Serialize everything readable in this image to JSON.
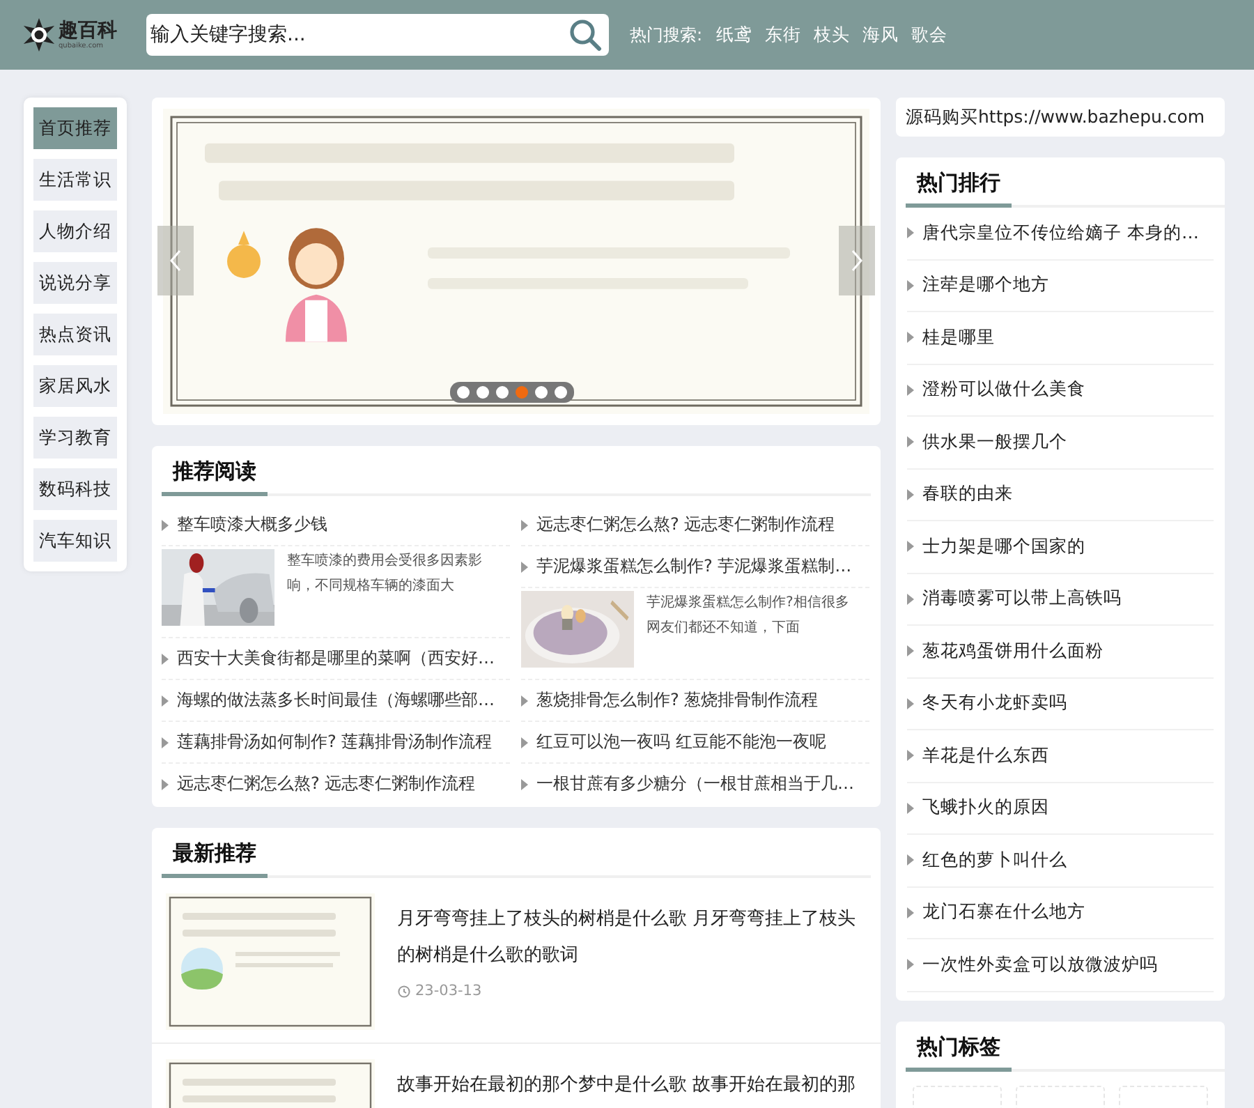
{
  "header": {
    "logo": {
      "name": "趣百科",
      "domain": "qubaike.com"
    },
    "search": {
      "placeholder": "输入关键字搜索..."
    },
    "hot_search": {
      "label": "热门搜索:",
      "terms": [
        "纸鸢",
        "东街",
        "枝头",
        "海风",
        "歌会"
      ]
    }
  },
  "nav": [
    {
      "label": "首页推荐",
      "selected": true
    },
    {
      "label": "生活常识",
      "selected": false
    },
    {
      "label": "人物介绍",
      "selected": false
    },
    {
      "label": "说说分享",
      "selected": false
    },
    {
      "label": "热点资讯",
      "selected": false
    },
    {
      "label": "家居风水",
      "selected": false
    },
    {
      "label": "学习教育",
      "selected": false
    },
    {
      "label": "数码科技",
      "selected": false
    },
    {
      "label": "汽车知识",
      "selected": false
    }
  ],
  "carousel": {
    "dots": [
      {
        "selected": false
      },
      {
        "selected": false
      },
      {
        "selected": false
      },
      {
        "selected": true
      },
      {
        "selected": false
      },
      {
        "selected": false
      }
    ]
  },
  "recommend": {
    "title": "推荐阅读",
    "columns": [
      [
        {
          "kind": "title",
          "text": "整车喷漆大概多少钱"
        },
        {
          "kind": "excerpt",
          "text": "整车喷漆的费用会受很多因素影响，不同规格车辆的漆面大"
        },
        {
          "kind": "title",
          "text": "西安十大美食街都是哪里的菜啊（西安好…"
        },
        {
          "kind": "title",
          "text": "海螺的做法蒸多长时间最佳（海螺哪些部…"
        },
        {
          "kind": "title",
          "text": "莲藕排骨汤如何制作? 莲藕排骨汤制作流程"
        },
        {
          "kind": "title",
          "text": "远志枣仁粥怎么熬? 远志枣仁粥制作流程"
        }
      ],
      [
        {
          "kind": "title",
          "text": "远志枣仁粥怎么熬? 远志枣仁粥制作流程"
        },
        {
          "kind": "title",
          "text": "芋泥爆浆蛋糕怎么制作? 芋泥爆浆蛋糕制…"
        },
        {
          "kind": "excerpt",
          "text": "芋泥爆浆蛋糕怎么制作?相信很多网友们都还不知道，下面"
        },
        {
          "kind": "title",
          "text": "葱烧排骨怎么制作? 葱烧排骨制作流程"
        },
        {
          "kind": "title",
          "text": "红豆可以泡一夜吗 红豆能不能泡一夜呢"
        },
        {
          "kind": "title",
          "text": "一根甘蔗有多少糖分（一根甘蔗相当于几…"
        }
      ]
    ]
  },
  "latest": {
    "title": "最新推荐",
    "items": [
      {
        "title": "月牙弯弯挂上了枝头的树梢是什么歌 月牙弯弯挂上了枝头的树梢是什么歌的歌词",
        "date": "23-03-13"
      },
      {
        "title": "故事开始在最初的那个梦中是什么歌 故事开始在最初的那"
      }
    ]
  },
  "source_note": "源码购买https://www.bazhepu.com",
  "hot_rank": {
    "title": "热门排行",
    "items": [
      "唐代宗皇位不传位给嫡子 本身的…",
      "注荦是哪个地方",
      "桂是哪里",
      "澄粉可以做什么美食",
      "供水果一般摆几个",
      "春联的由来",
      "士力架是哪个国家的",
      "消毒喷雾可以带上高铁吗",
      "葱花鸡蛋饼用什么面粉",
      "冬天有小龙虾卖吗",
      "羊花是什么东西",
      "飞蛾扑火的原因",
      "红色的萝卜叫什么",
      "龙门石寨在什么地方",
      "一次性外卖盒可以放微波炉吗"
    ]
  },
  "hot_tags": {
    "title": "热门标签"
  }
}
